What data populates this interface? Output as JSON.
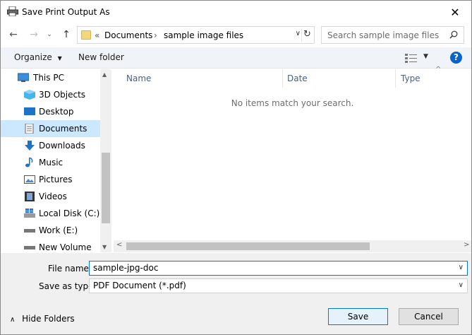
{
  "window": {
    "title": "Save Print Output As",
    "close_icon": "close-icon"
  },
  "navbar": {
    "breadcrumb_prefix": "«",
    "crumbs": [
      "Documents",
      "sample image files"
    ],
    "search_placeholder": "Search sample image files"
  },
  "toolbar": {
    "organize_label": "Organize",
    "new_folder_label": "New folder",
    "help_label": "?"
  },
  "sidebar": {
    "items": [
      {
        "label": "This PC",
        "icon": "pc-icon"
      },
      {
        "label": "3D Objects",
        "icon": "3d-objects-icon"
      },
      {
        "label": "Desktop",
        "icon": "desktop-icon"
      },
      {
        "label": "Documents",
        "icon": "documents-icon",
        "selected": true
      },
      {
        "label": "Downloads",
        "icon": "downloads-icon"
      },
      {
        "label": "Music",
        "icon": "music-icon"
      },
      {
        "label": "Pictures",
        "icon": "pictures-icon"
      },
      {
        "label": "Videos",
        "icon": "videos-icon"
      },
      {
        "label": "Local Disk (C:)",
        "icon": "drive-icon"
      },
      {
        "label": "Work  (E:)",
        "icon": "drive-icon"
      },
      {
        "label": "New Volume (F:)",
        "icon": "drive-icon"
      }
    ]
  },
  "filelist": {
    "columns": [
      "Name",
      "Date",
      "Type"
    ],
    "empty_message": "No items match your search."
  },
  "form": {
    "file_name_label": "File name:",
    "file_name_value": "sample-jpg-doc",
    "save_type_label": "Save as type:",
    "save_type_value": "PDF Document (*.pdf)"
  },
  "footer": {
    "hide_folders_label": "Hide Folders",
    "save_label": "Save",
    "cancel_label": "Cancel"
  },
  "colors": {
    "accent": "#0078d7",
    "selected_bg": "#cce8ff",
    "toolbar_bg": "#f0f4f9",
    "help_blue": "#0a63c9"
  }
}
